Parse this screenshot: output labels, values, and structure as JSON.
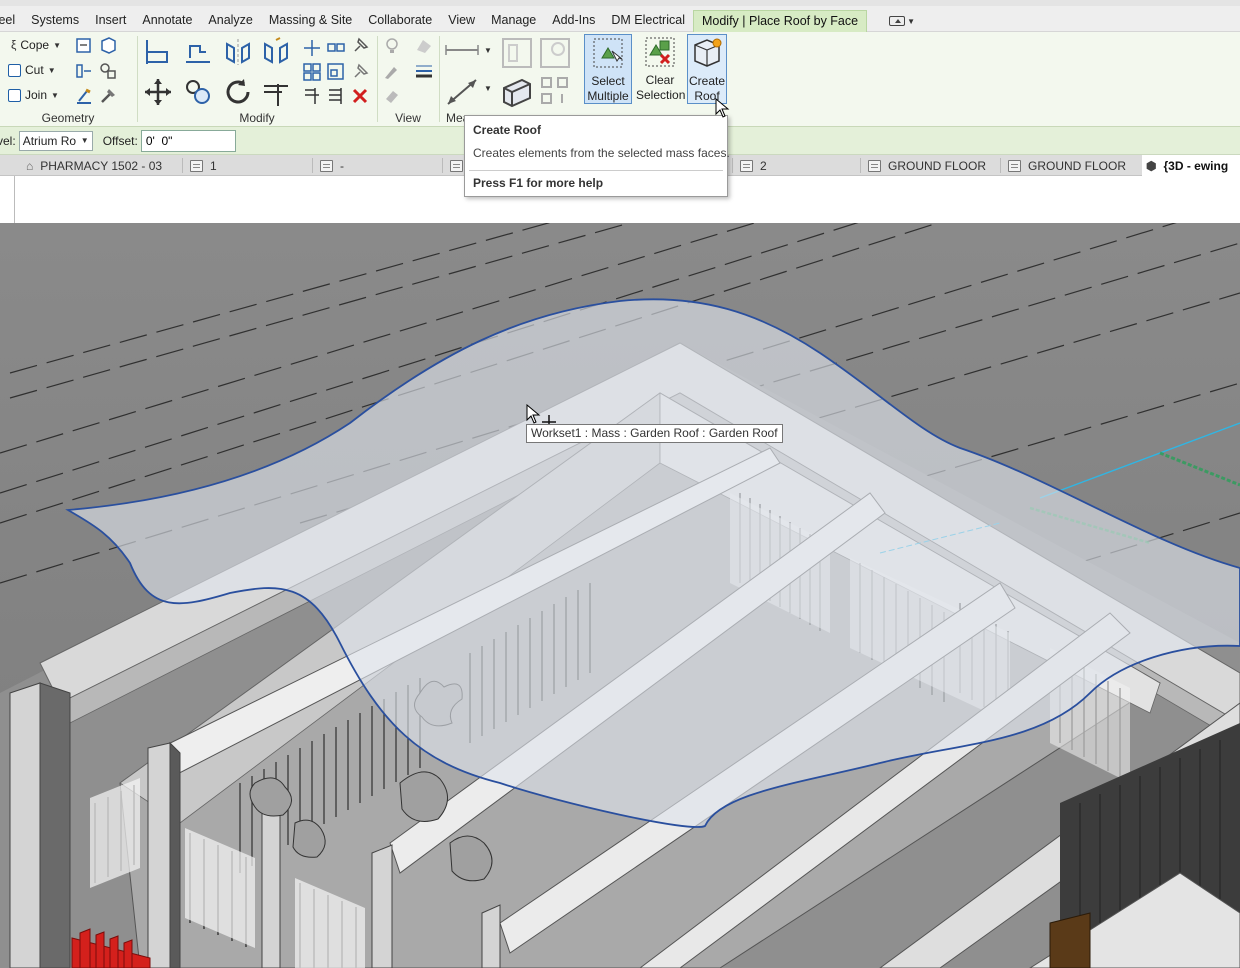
{
  "menu": {
    "tabs": [
      {
        "label": "teel",
        "active": false
      },
      {
        "label": "Systems",
        "active": false
      },
      {
        "label": "Insert",
        "active": false
      },
      {
        "label": "Annotate",
        "active": false
      },
      {
        "label": "Analyze",
        "active": false
      },
      {
        "label": "Massing & Site",
        "active": false
      },
      {
        "label": "Collaborate",
        "active": false
      },
      {
        "label": "View",
        "active": false
      },
      {
        "label": "Manage",
        "active": false
      },
      {
        "label": "Add-Ins",
        "active": false
      },
      {
        "label": "DM Electrical",
        "active": false
      },
      {
        "label": "Modify | Place Roof by Face",
        "active": true
      }
    ]
  },
  "ribbon": {
    "geometry": {
      "label": "Geometry",
      "cope": "Cope",
      "cut": "Cut",
      "join": "Join"
    },
    "modify": {
      "label": "Modify"
    },
    "view": {
      "label": "View"
    },
    "measure": {
      "label": "Mea"
    },
    "select_multiple": {
      "line1": "Select",
      "line2": "Multiple"
    },
    "clear_selection": {
      "line1": "Clear",
      "line2": "Selection"
    },
    "create_roof": {
      "line1": "Create",
      "line2": "Roof"
    }
  },
  "options_bar": {
    "level_label": "vel:",
    "level_value": "Atrium Ro",
    "offset_label": "Offset:",
    "offset_value": "0'  0\""
  },
  "view_tabs": [
    {
      "label": "PHARMACY 1502 - 03",
      "active": false
    },
    {
      "label": "1",
      "active": false
    },
    {
      "label": "-",
      "active": false
    },
    {
      "label": "2",
      "active": false
    },
    {
      "label": "GROUND FLOOR",
      "active": false
    },
    {
      "label": "GROUND FLOOR",
      "active": false
    },
    {
      "label": "{3D - ewing",
      "active": true
    }
  ],
  "tooltip": {
    "title": "Create Roof",
    "description": "Creates elements from the selected mass faces.",
    "help": "Press F1 for more help"
  },
  "hover_label": "Workset1 : Mass : Garden Roof : Garden Roof",
  "colors": {
    "active_tab": "#d7ebc4",
    "ribbon_bg": "#f3f8ee",
    "options_bg": "#e4f0d9",
    "mass_outline": "#2a4f9e",
    "selected_button": "#cfe3f7"
  }
}
